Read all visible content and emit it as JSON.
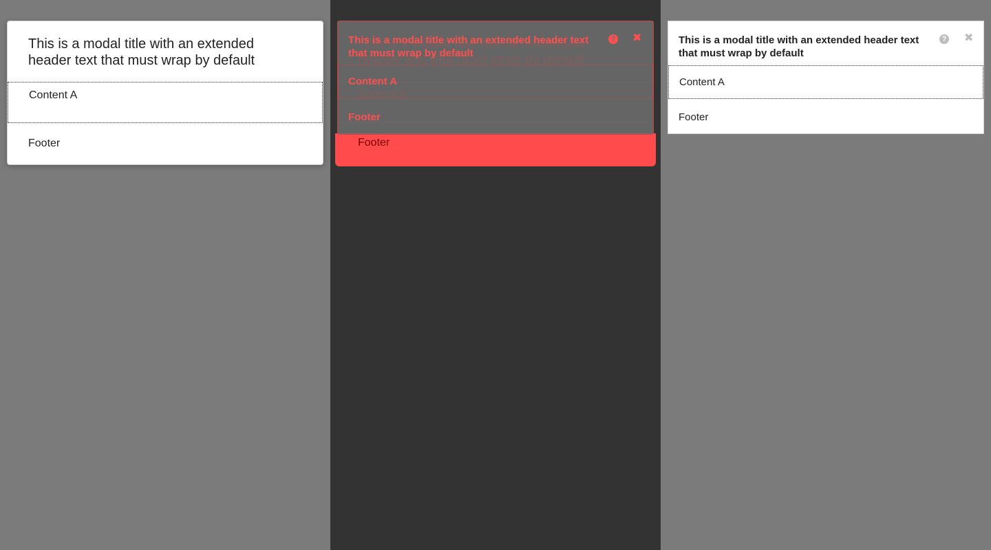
{
  "modal": {
    "title": "This is a modal title with an extended header text that must wrap by default",
    "content": "Content A",
    "footer": "Footer",
    "help_icon": "?",
    "close_icon": "✖"
  },
  "icons": {
    "help": "question-circle-icon",
    "close": "close-icon"
  },
  "colors": {
    "backdrop": "#7b7b7b",
    "diff_background": "#333333",
    "diff_highlight": "#ff4b4b",
    "diff_text": "#d40000",
    "icon_muted": "#bdbdbd"
  }
}
